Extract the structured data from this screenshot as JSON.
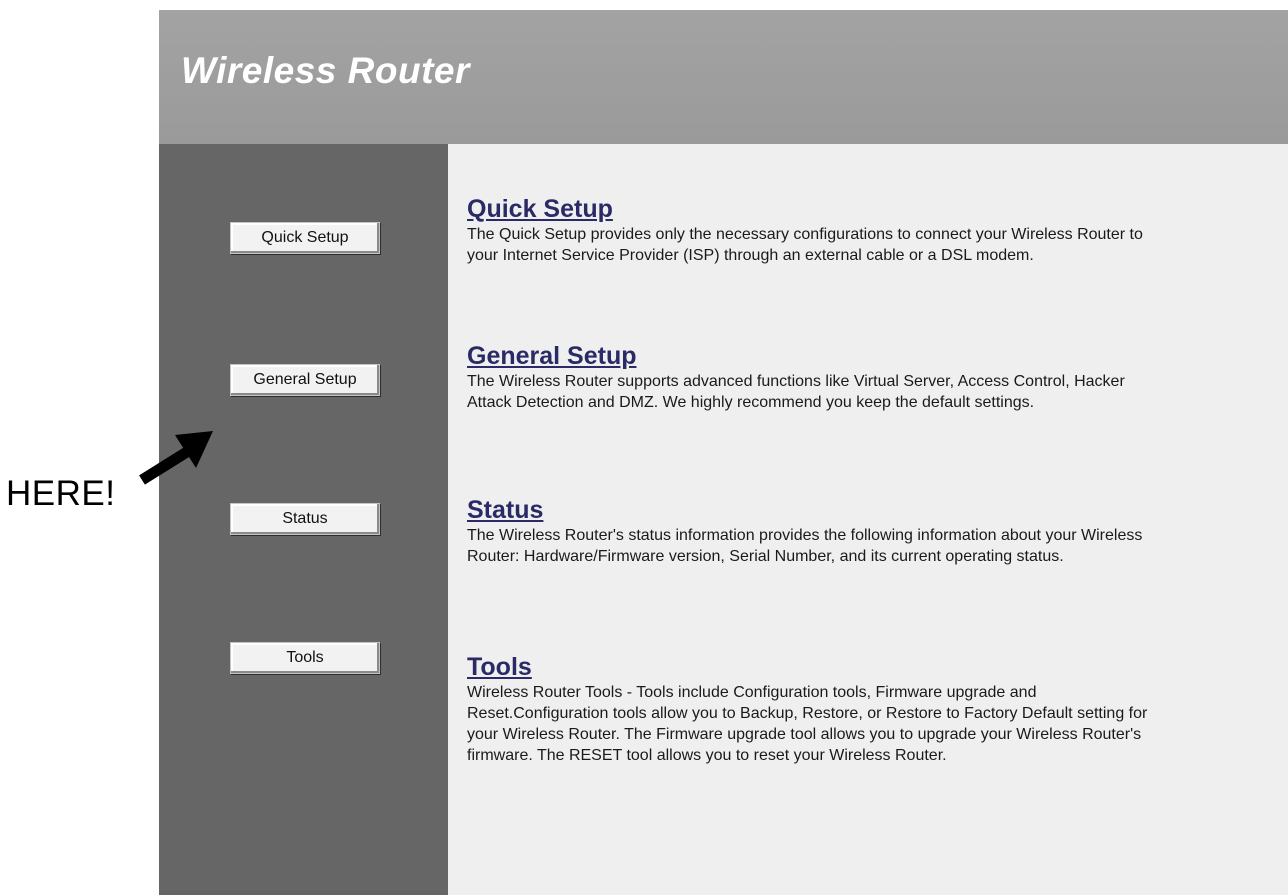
{
  "header": {
    "title": "Wireless Router"
  },
  "sidebar": {
    "buttons": [
      {
        "label": "Quick Setup"
      },
      {
        "label": "General Setup"
      },
      {
        "label": "Status"
      },
      {
        "label": "Tools"
      }
    ]
  },
  "main": {
    "sections": [
      {
        "title": "Quick Setup",
        "description": "The Quick Setup provides only the necessary configurations to connect your Wireless Router to your Internet Service Provider (ISP) through an external cable or a DSL modem."
      },
      {
        "title": "General Setup",
        "description": "The Wireless Router supports advanced functions like Virtual Server, Access Control, Hacker Attack Detection and DMZ. We highly recommend you keep the default settings."
      },
      {
        "title": "Status",
        "description": "The Wireless Router's status information provides the following information about your Wireless Router: Hardware/Firmware version, Serial Number, and its current operating status."
      },
      {
        "title": "Tools",
        "description": "Wireless Router Tools - Tools include Configuration tools, Firmware upgrade and Reset.Configuration tools allow you to Backup, Restore, or Restore to Factory Default setting for your Wireless Router. The Firmware upgrade tool allows you to upgrade your Wireless Router's firmware. The RESET tool allows you to reset your Wireless Router."
      }
    ]
  },
  "annotation": {
    "label": "HERE!",
    "icon": "arrow-icon"
  }
}
